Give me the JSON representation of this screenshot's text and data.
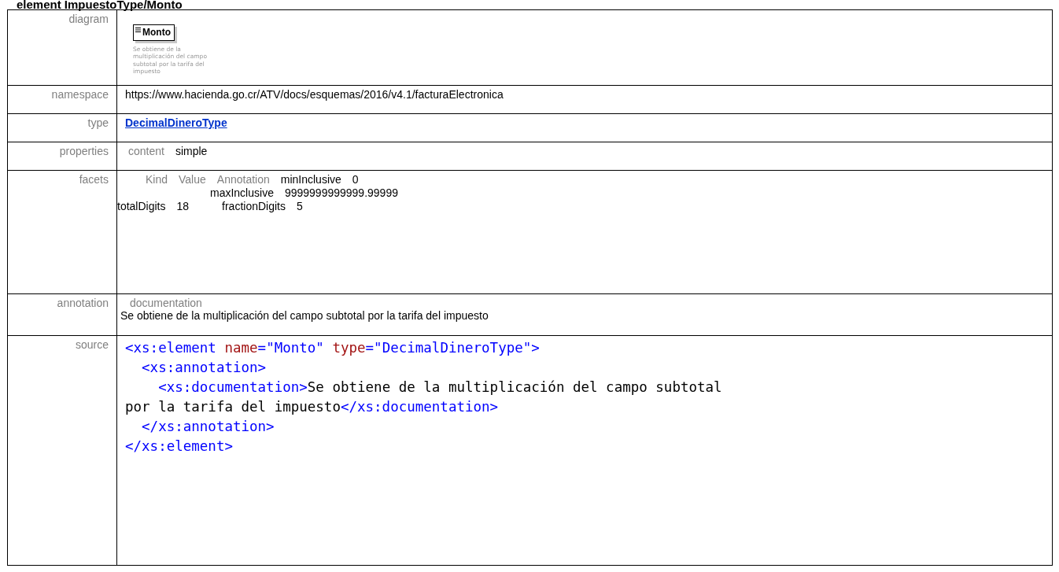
{
  "title": "element ImpuestoType/Monto",
  "rows": [
    {
      "kind": "diagram",
      "label": "diagram",
      "element": "Monto",
      "caption": "Se obtiene de la multiplicación del campo subtotal por la tarifa del impuesto"
    },
    {
      "kind": "text",
      "label": "namespace",
      "value": "https://www.hacienda.go.cr/ATV/docs/esquemas/2016/v4.1/facturaElectronica"
    },
    {
      "kind": "link",
      "label": "type",
      "value": "DecimalDineroType"
    },
    {
      "kind": "properties",
      "label": "properties",
      "name": "content",
      "value": "simple"
    },
    {
      "kind": "facets",
      "label": "facets",
      "columns": [
        "Kind",
        "Value",
        "Annotation"
      ],
      "items": [
        {
          "name": "minInclusive",
          "value": "0"
        },
        {
          "name": "maxInclusive",
          "value": "9999999999999.99999"
        },
        {
          "name": "totalDigits",
          "value": "18"
        },
        {
          "name": "fractionDigits",
          "value": "5"
        }
      ]
    },
    {
      "kind": "annotation",
      "label": "annotation",
      "heading": "documentation",
      "value": "Se obtiene de la multiplicación del campo subtotal por la tarifa del impuesto"
    },
    {
      "kind": "source",
      "label": "source",
      "lines": [
        [
          {
            "kind": "tag",
            "text": "<xs:element "
          },
          {
            "kind": "attr",
            "text": "name"
          },
          {
            "kind": "tag",
            "text": "=\"Monto\" "
          },
          {
            "kind": "attr",
            "text": "type"
          },
          {
            "kind": "tag",
            "text": "=\"DecimalDineroType\">"
          }
        ],
        [
          {
            "kind": "tag",
            "text": "  <xs:annotation>"
          }
        ],
        [
          {
            "kind": "tag",
            "text": "    <xs:documentation>"
          },
          {
            "kind": "text",
            "text": "Se obtiene de la multiplicación del campo subtotal por la tarifa del impuesto"
          },
          {
            "kind": "tag",
            "text": "</xs:documentation>"
          }
        ],
        [
          {
            "kind": "tag",
            "text": "  </xs:annotation>"
          }
        ],
        [
          {
            "kind": "tag",
            "text": "</xs:element>"
          }
        ]
      ]
    }
  ]
}
